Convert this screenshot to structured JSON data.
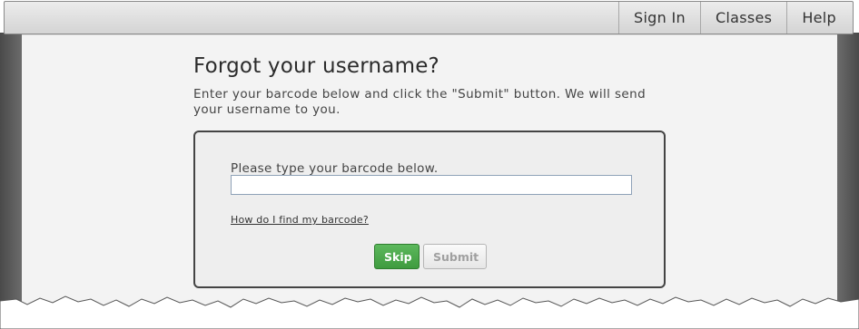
{
  "nav": {
    "items": [
      {
        "label": "Sign In"
      },
      {
        "label": "Classes"
      },
      {
        "label": "Help"
      }
    ]
  },
  "main": {
    "title": "Forgot your username?",
    "instructions": "Enter your barcode below and click the \"Submit\" button. We will send your username to you.",
    "form": {
      "label": "Please type your barcode below.",
      "barcode_value": "",
      "help_link": "How do I find my barcode?",
      "skip_label": "Skip",
      "submit_label": "Submit"
    }
  },
  "colors": {
    "skip_button": "#4cae4c",
    "submit_text_disabled": "#a0a0a0",
    "panel_border": "#444444",
    "page_background": "#f3f3f3"
  }
}
